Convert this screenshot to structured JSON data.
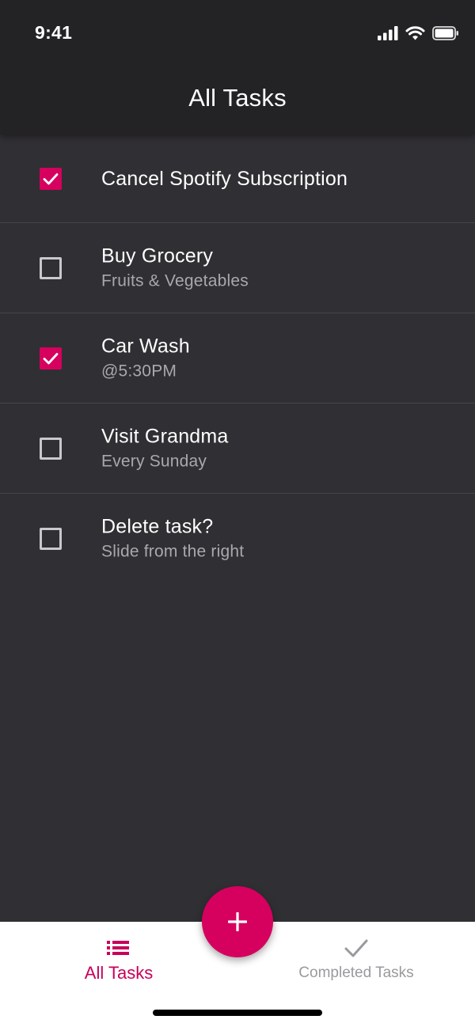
{
  "status_bar": {
    "time": "9:41"
  },
  "header": {
    "title": "All Tasks"
  },
  "tasks": [
    {
      "title": "Cancel Spotify Subscription",
      "subtitle": "",
      "checked": true
    },
    {
      "title": "Buy Grocery",
      "subtitle": "Fruits & Vegetables",
      "checked": false
    },
    {
      "title": "Car Wash",
      "subtitle": "@5:30PM",
      "checked": true
    },
    {
      "title": "Visit Grandma",
      "subtitle": "Every Sunday",
      "checked": false
    },
    {
      "title": "Delete task?",
      "subtitle": "Slide from the right",
      "checked": false
    }
  ],
  "fab": {
    "icon": "plus-icon"
  },
  "bottom_nav": {
    "items": [
      {
        "label": "All Tasks",
        "icon": "list-icon",
        "active": true
      },
      {
        "label": "Completed Tasks",
        "icon": "checkmark-icon",
        "active": false
      }
    ]
  },
  "colors": {
    "accent": "#d6005f",
    "background": "#302f33",
    "header": "#232224",
    "nav_inactive": "#9a9a9e"
  }
}
